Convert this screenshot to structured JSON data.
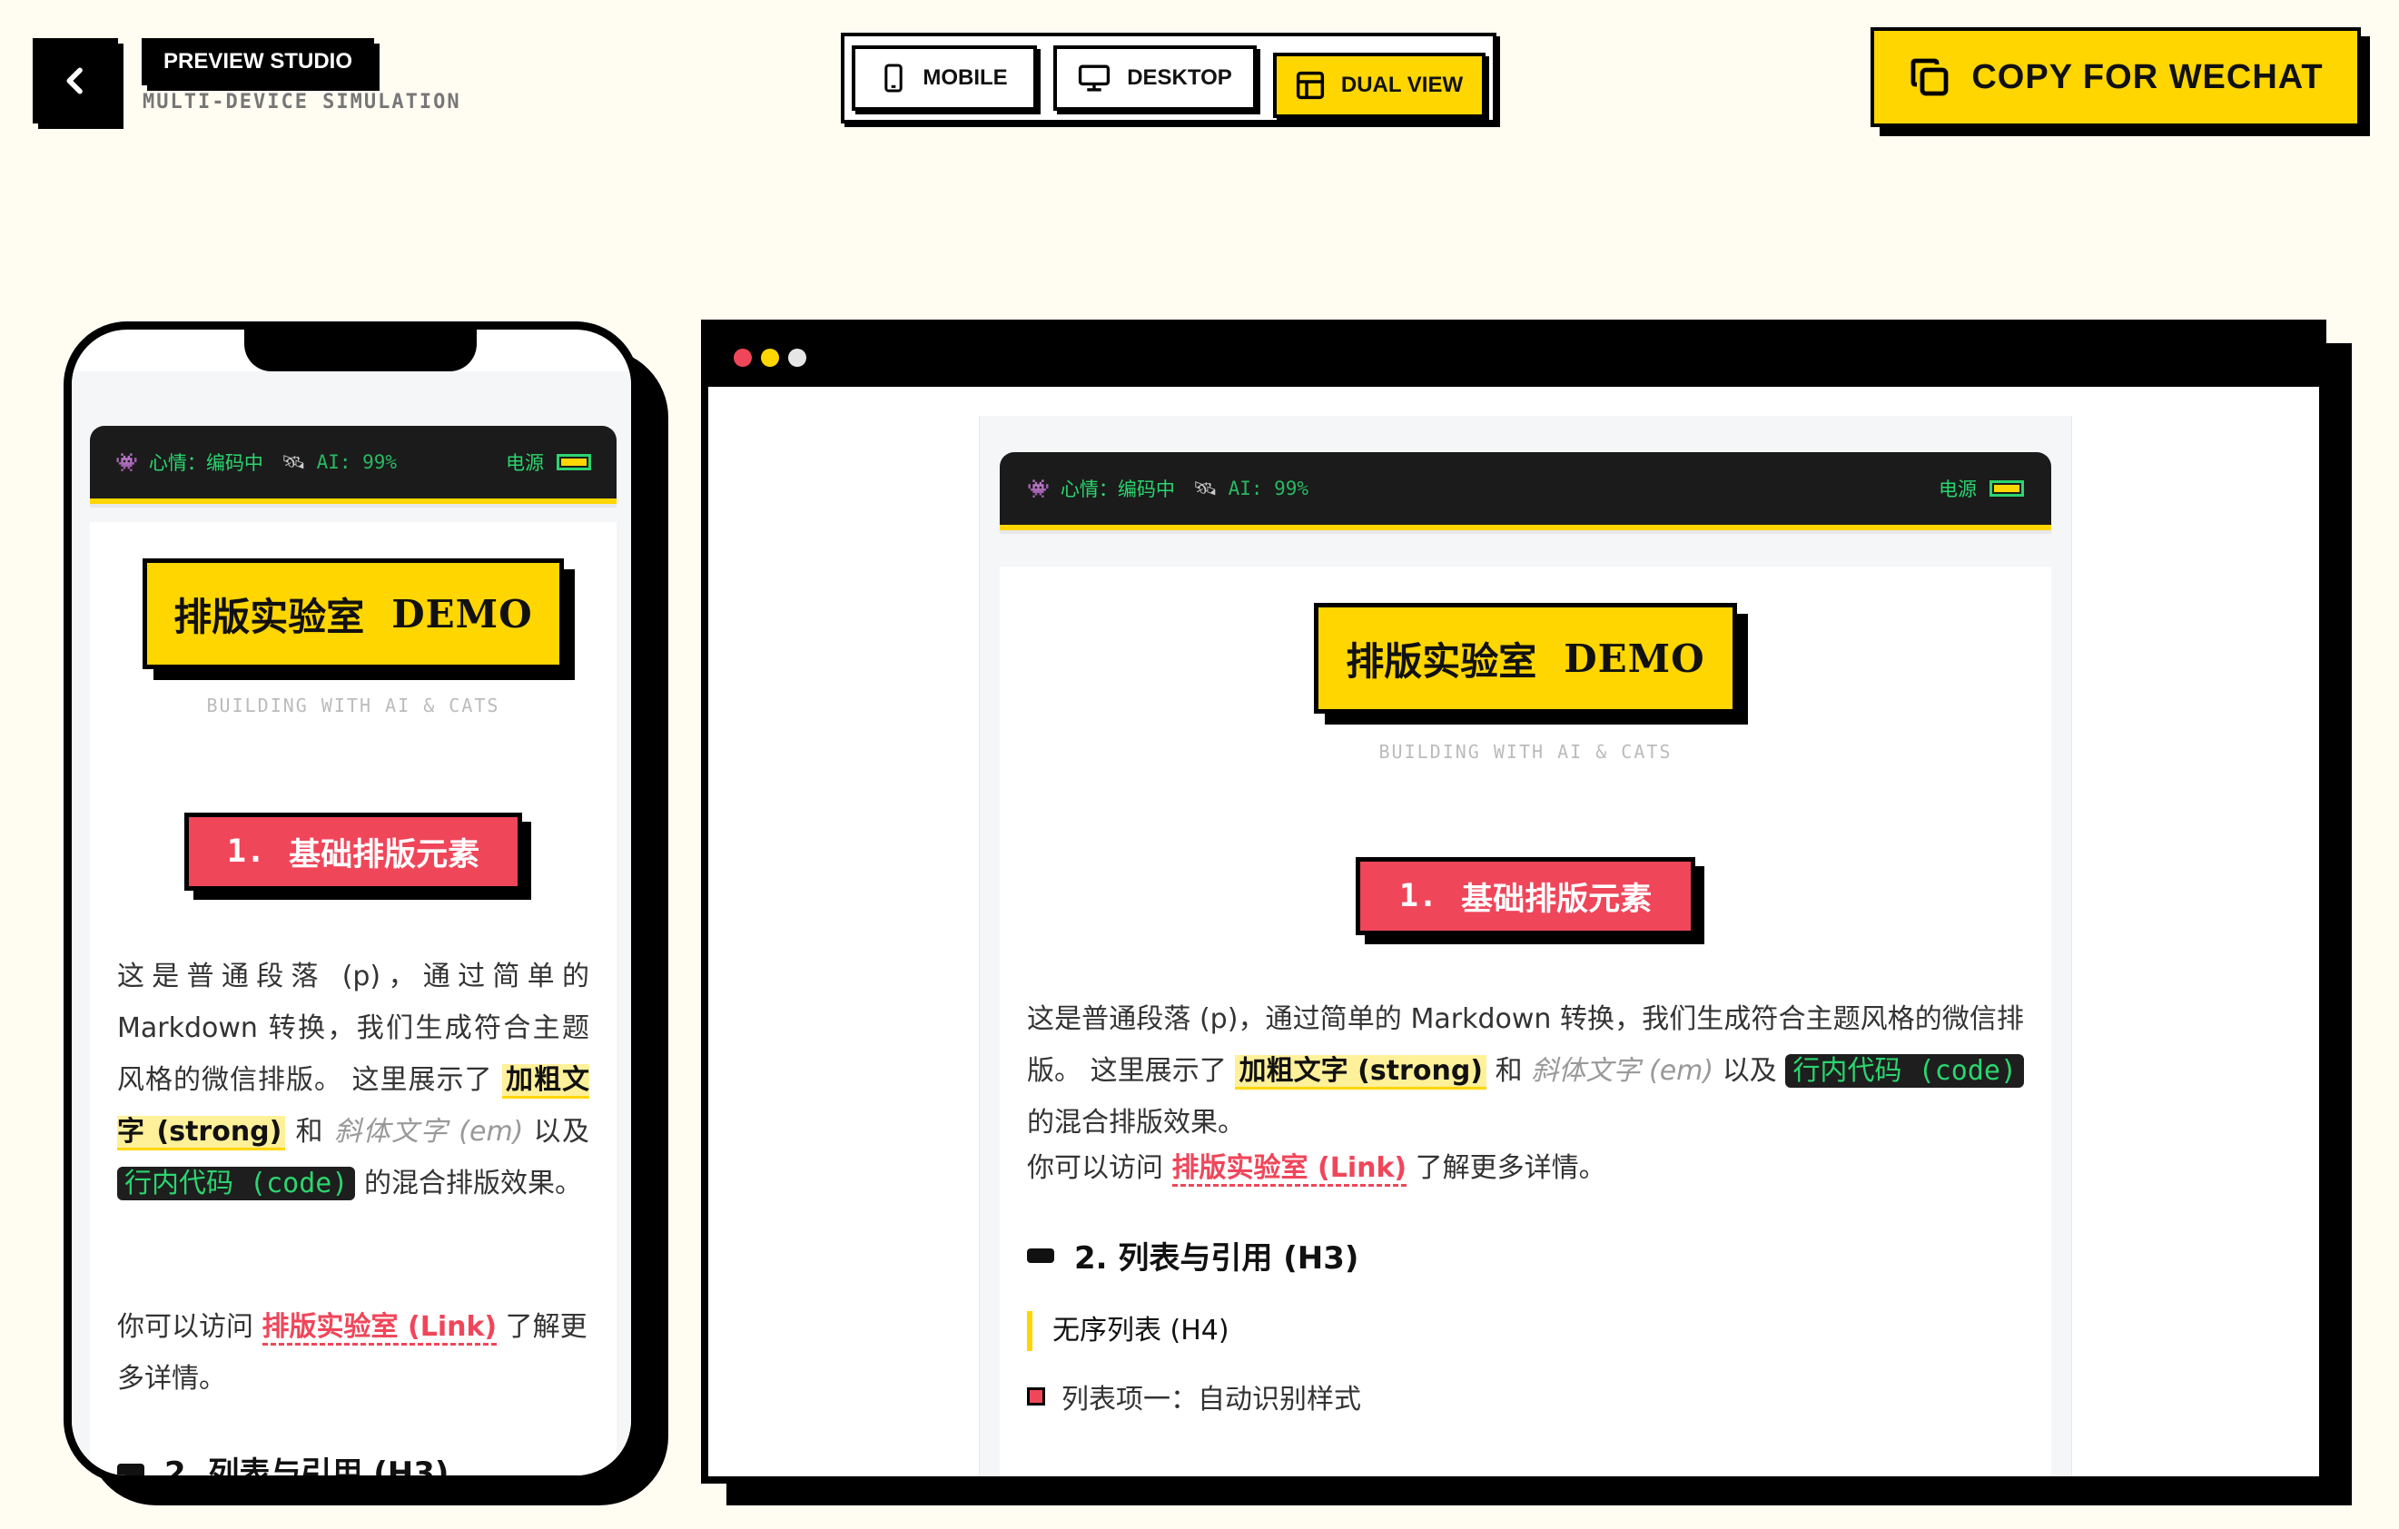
{
  "header": {
    "back_label": "Back",
    "studio_title": "PREVIEW STUDIO",
    "studio_subtitle": "MULTI-DEVICE SIMULATION",
    "view_modes": [
      {
        "label": "MOBILE",
        "icon": "smartphone-icon",
        "active": false
      },
      {
        "label": "DESKTOP",
        "icon": "monitor-icon",
        "active": false
      },
      {
        "label": "DUAL VIEW",
        "icon": "layout-icon",
        "active": true
      }
    ],
    "copy_label": "COPY FOR WECHAT"
  },
  "preview": {
    "status": {
      "mood": "心情：编码中",
      "ai": "AI: 99%",
      "power": "电源",
      "battery_level": 1
    },
    "hero_title": "排版实验室",
    "hero_demo": "DEMO",
    "hero_subtitle": "BUILDING WITH AI & CATS",
    "section1_num": "1.",
    "section1_title": "基础排版元素",
    "para1_a": "这是普通段落 (p)，通过简单的 Markdown 转换，我们生成符合主题风格的微信排版。 这里展示了",
    "para1_strong": "加粗文字 (strong)",
    "para1_b": "和",
    "para1_em": "斜体文字 (em)",
    "para1_c": "以及",
    "para1_code": "行内代码 (code)",
    "para1_d": "的混合排版效果。",
    "para2_a": "你可以访问",
    "para2_link": "排版实验室 (Link)",
    "para2_b": "了解更多详情。",
    "section2_title": "2. 列表与引用 (H3)",
    "section2_h4": "无序列表 (H4)",
    "list_item1": "列表项一：自动识别样式"
  },
  "colors": {
    "accent_yellow": "#ffd600",
    "accent_red": "#f0465a",
    "code_green": "#2bd56f",
    "background": "#fffcf2"
  }
}
